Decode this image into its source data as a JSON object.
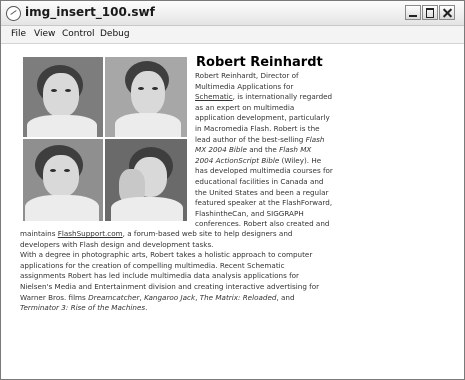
{
  "window": {
    "title": "img_insert_100.swf"
  },
  "menu": [
    "File",
    "View",
    "Control",
    "Debug"
  ],
  "profile": {
    "name": "Robert Reinhardt",
    "narrow_lines": [
      [
        "Robert Reinhardt, Director of"
      ],
      [
        "Multimedia Applications for"
      ],
      [
        "{Schematic}",
        ", is internationally regarded"
      ],
      [
        "as an expert on multimedia"
      ],
      [
        "application development, particularly"
      ],
      [
        "in Macromedia Flash. Robert is the"
      ],
      [
        "lead author of the best-selling ",
        "[Flash"
      ],
      [
        "[MX 2004 Bible",
        " and the ",
        "[Flash MX"
      ],
      [
        "[2004 ActionScript Bible",
        " (Wiley). He"
      ],
      [
        "has developed multimedia courses for"
      ],
      [
        "educational facilities in Canada and"
      ],
      [
        "the United States and been a regular"
      ],
      [
        "featured speaker at the FlashForward,"
      ],
      [
        "FlashintheCan, and SIGGRAPH"
      ],
      [
        "conferences. Robert also created and"
      ]
    ],
    "wide_lines": [
      [
        "maintains ",
        "{FlashSupport.com",
        ", a forum-based web site to help designers and"
      ],
      [
        "developers with Flash design and development tasks."
      ],
      [
        "With a degree in photographic arts, Robert takes a holistic approach to computer"
      ],
      [
        "applications for the creation of compelling multimedia. Recent Schematic"
      ],
      [
        "assignments Robert has led include multimedia data analysis applications for"
      ],
      [
        "Nielsen's Media and Entertainment division and creating interactive advertising for"
      ],
      [
        "Warner Bros. films ",
        "[Dreamcatcher",
        ", ",
        "[Kangaroo Jack",
        ", ",
        "[The Matrix: Reloaded",
        ", and"
      ],
      [
        "[Terminator 3: Rise of the Machines",
        "."
      ]
    ]
  }
}
